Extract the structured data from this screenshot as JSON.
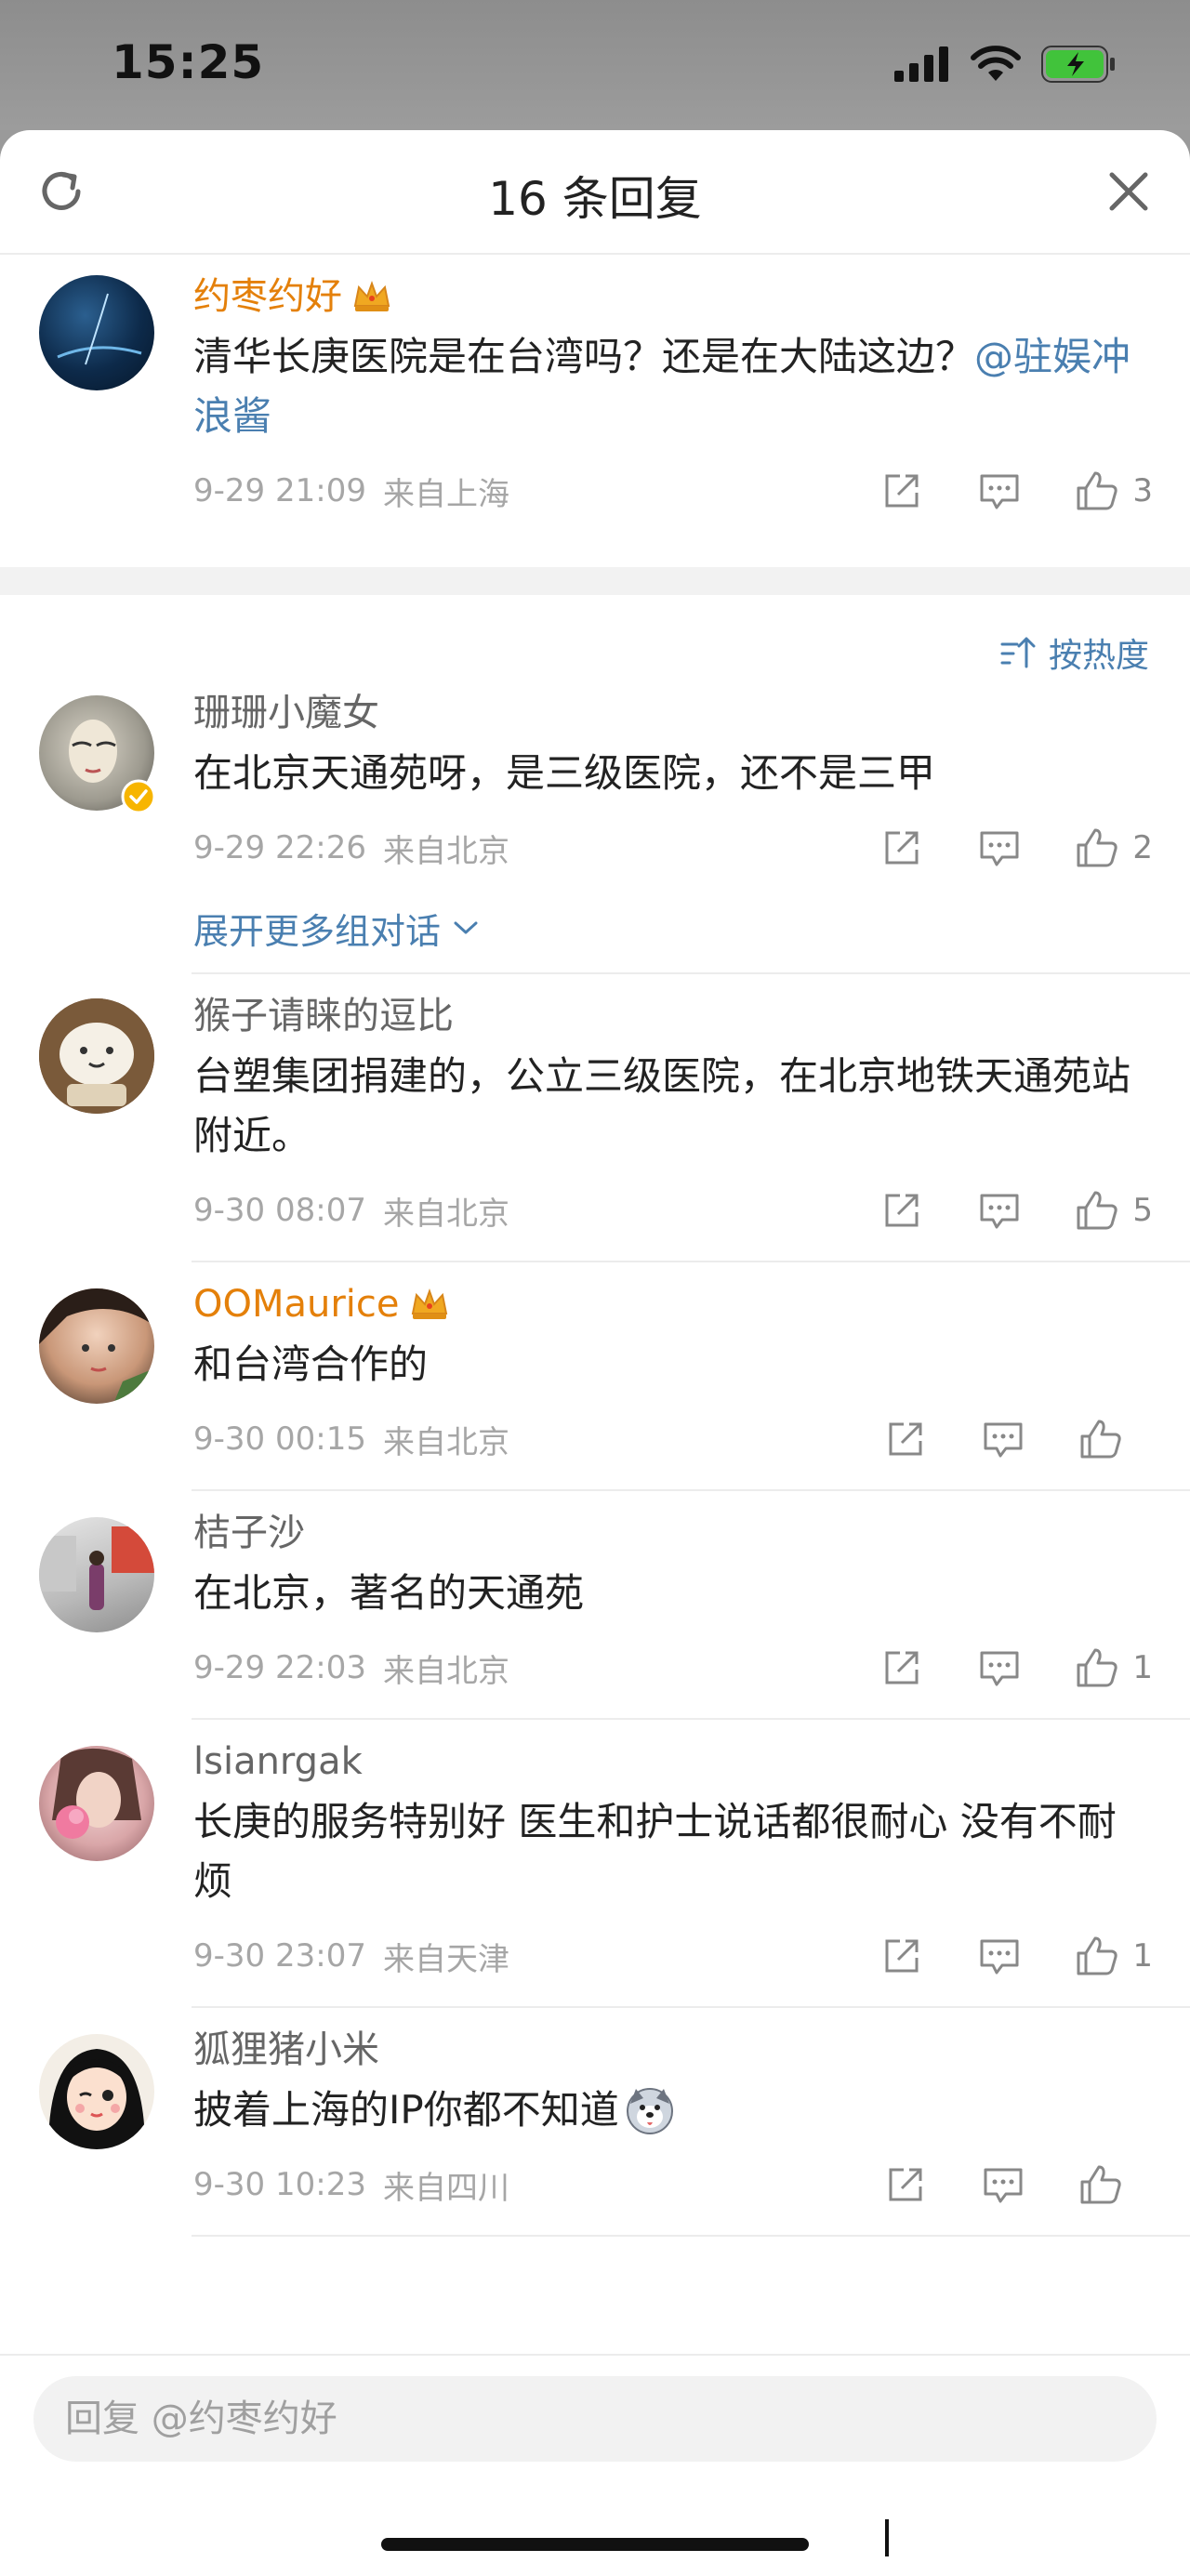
{
  "status_bar": {
    "time": "15:25"
  },
  "sheet": {
    "title": "16 条回复"
  },
  "root_comment": {
    "username": "约枣约好",
    "text": "清华长庚医院是在台湾吗？还是在大陆这边？",
    "mention": "@驻娱冲浪酱",
    "time": "9-29 21:09",
    "location": "来自上海",
    "likes": "3"
  },
  "sort": {
    "label": "按热度"
  },
  "replies": [
    {
      "username": "珊珊小魔女",
      "text": "在北京天通苑呀，是三级医院，还不是三甲",
      "time": "9-29 22:26",
      "location": "来自北京",
      "likes": "2",
      "expand": "展开更多组对话"
    },
    {
      "username": "猴子请睐的逗比",
      "text": "台塑集团捐建的，公立三级医院，在北京地铁天通苑站附近。",
      "time": "9-30 08:07",
      "location": "来自北京",
      "likes": "5"
    },
    {
      "username": "OOMaurice",
      "text": "和台湾合作的",
      "time": "9-30 00:15",
      "location": "来自北京",
      "likes": ""
    },
    {
      "username": "桔子沙",
      "text": "在北京，著名的天通苑",
      "time": "9-29 22:03",
      "location": "来自北京",
      "likes": "1"
    },
    {
      "username": "lsianrgak",
      "text": "长庚的服务特别好 医生和护士说话都很耐心 没有不耐烦",
      "time": "9-30 23:07",
      "location": "来自天津",
      "likes": "1"
    },
    {
      "username": "狐狸猪小米",
      "text": "披着上海的IP你都不知道",
      "time": "9-30 10:23",
      "location": "来自四川",
      "likes": ""
    }
  ],
  "reply_box": {
    "placeholder": "回复 @约枣约好"
  },
  "colors": {
    "accent_blue": "#4a7fb0",
    "vip_orange": "#e4800a",
    "meta_gray": "#a6a6a6"
  }
}
